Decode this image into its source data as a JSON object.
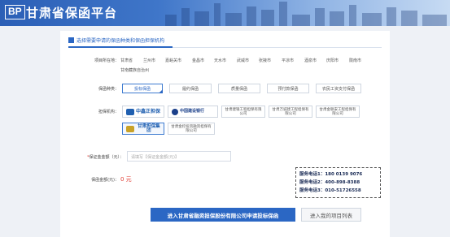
{
  "header": {
    "logo_text": "BP",
    "title": "甘肃省保函平台"
  },
  "section": {
    "title": "选择需要申请的保函种类和保函担保机构"
  },
  "region": {
    "label": "项目所在地：",
    "cities": [
      "甘肃省",
      "兰州市",
      "嘉峪关市",
      "金昌市",
      "天水市",
      "武威市",
      "张掖市",
      "平凉市",
      "酒泉市",
      "庆阳市",
      "陇南市",
      "甘南藏族自治州"
    ]
  },
  "guarantee_type": {
    "label": "保函种类：",
    "options": [
      "投标保函",
      "履约保函",
      "质量保函",
      "预付款保函",
      "农民工资支付保函"
    ],
    "selected": "投标保函"
  },
  "institution": {
    "label": "担保机构：",
    "items": [
      "中鑫正担保",
      "中国建设银行",
      "甘肃建银工程担保有限公司",
      "甘肃万诚建工程担保有限公司",
      "甘肃金联安工程担保有限公司",
      "甘肃担保集团",
      "甘肃金控投资融资担保有限公司"
    ],
    "selected": "甘肃担保集团"
  },
  "amount": {
    "required_mark": "*",
    "label": "保证金金额（元）：",
    "placeholder": "请填写【保证金金额(元)】"
  },
  "fee": {
    "label": "保函金额(元)：",
    "value": "0 元"
  },
  "contact": {
    "lines": [
      "服务电话1：180 0139 9076",
      "服务电话2：400-898-8388",
      "服务电话3：010-51726558"
    ]
  },
  "actions": {
    "apply": "进入甘肃省融资担保股份有限公司申请投标保函",
    "my_projects": "进入我的项目列表"
  },
  "colors": {
    "primary": "#2b67c4",
    "danger": "#e03b32"
  }
}
